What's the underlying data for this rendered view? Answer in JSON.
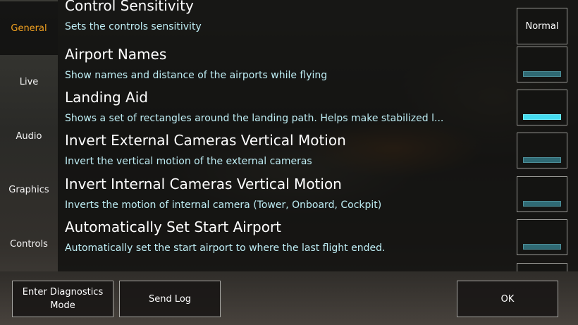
{
  "sidebar": {
    "tabs": [
      {
        "label": "General",
        "active": true
      },
      {
        "label": "Live",
        "active": false
      },
      {
        "label": "Audio",
        "active": false
      },
      {
        "label": "Graphics",
        "active": false
      },
      {
        "label": "Controls",
        "active": false
      }
    ]
  },
  "settings": [
    {
      "title": "Control Sensitivity",
      "description": "Sets the controls sensitivity",
      "control": "select",
      "value": "Normal"
    },
    {
      "title": "Airport Names",
      "description": "Show names and distance of the airports while flying",
      "control": "toggle",
      "enabled": false
    },
    {
      "title": "Landing Aid",
      "description": "Shows a set of rectangles around the landing path. Helps make stabilized l...",
      "control": "toggle",
      "enabled": true
    },
    {
      "title": "Invert External Cameras Vertical Motion",
      "description": "Invert the vertical motion of the external cameras",
      "control": "toggle",
      "enabled": false
    },
    {
      "title": "Invert Internal Cameras Vertical Motion",
      "description": "Inverts the motion of internal camera (Tower, Onboard, Cockpit)",
      "control": "toggle",
      "enabled": false
    },
    {
      "title": "Automatically Set Start Airport",
      "description": "Automatically set the start airport to where the last flight ended.",
      "control": "toggle",
      "enabled": false
    }
  ],
  "buttons": {
    "diagnostics_line1": "Enter Diagnostics",
    "diagnostics_line2": "Mode",
    "send_log": "Send Log",
    "ok": "OK"
  },
  "colors": {
    "active_tab": "#f0a020",
    "description_text": "#bfeef5",
    "toggle_on": "#45dcf0",
    "toggle_off": "#2f6a74"
  }
}
